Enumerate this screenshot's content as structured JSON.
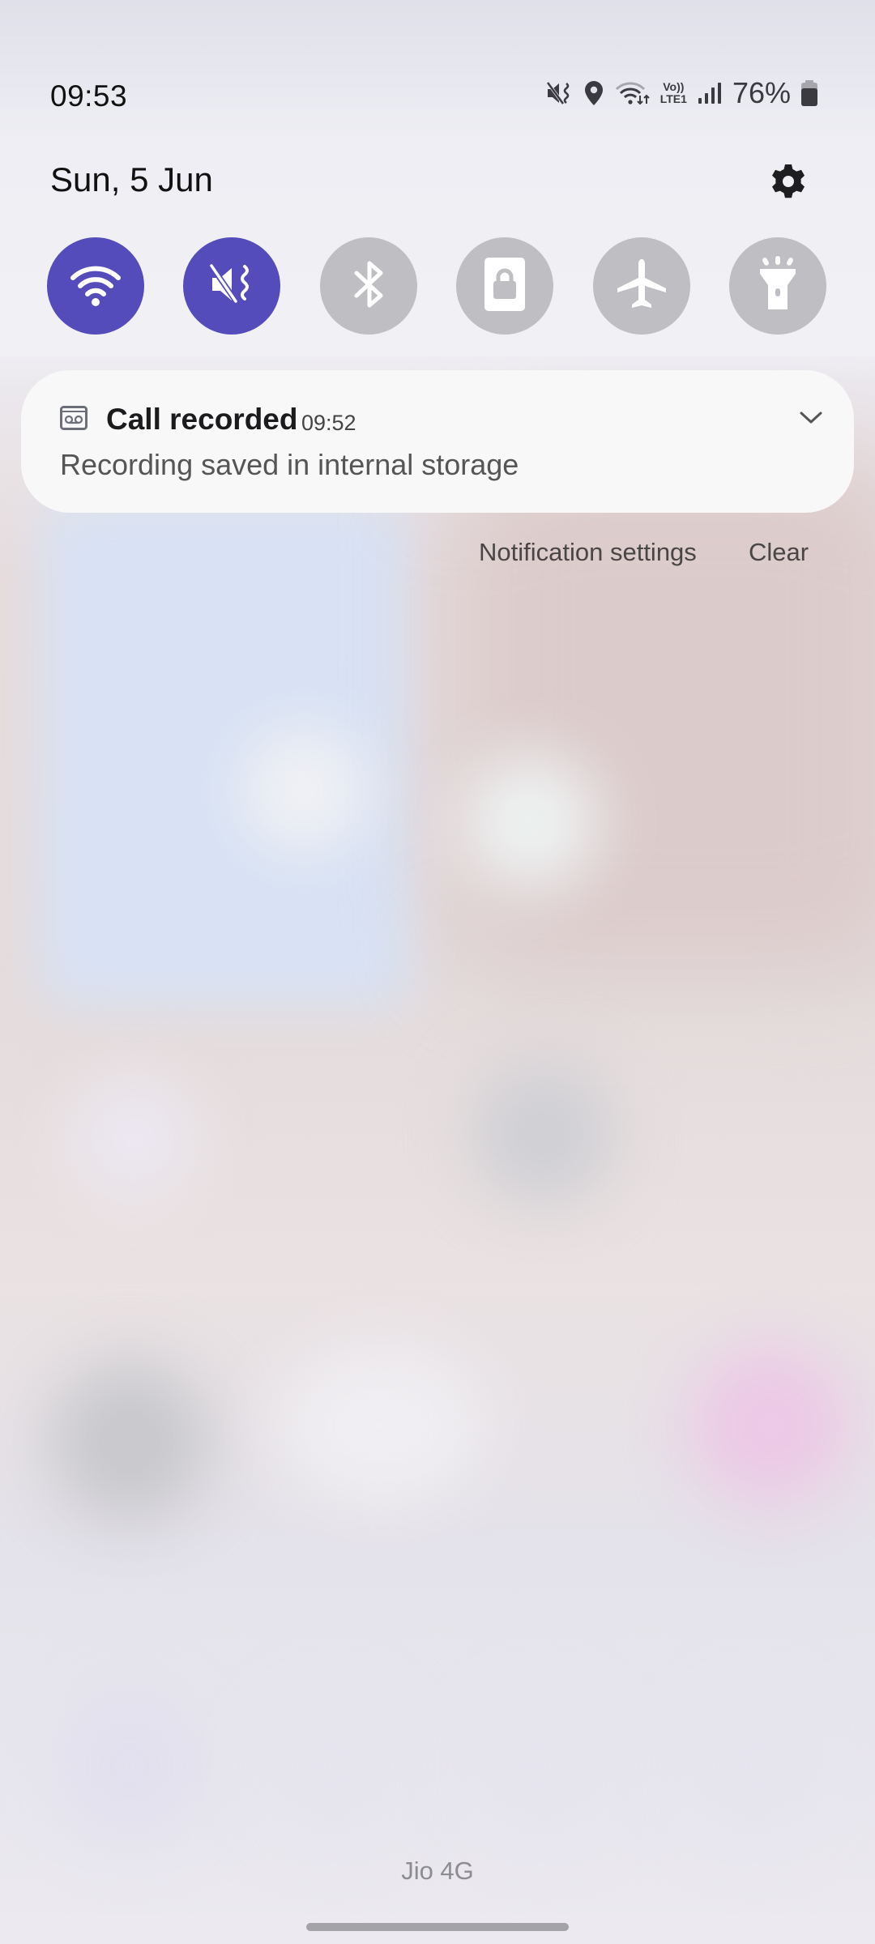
{
  "status_bar": {
    "time": "09:53",
    "icons": [
      "mute-vibrate-icon",
      "location-icon",
      "wifi-data-icon",
      "volte-lte-icon",
      "signal-icon"
    ],
    "volte_label_top": "Vo))",
    "volte_label_bottom": "LTE1",
    "battery_percent": "76%"
  },
  "header": {
    "date": "Sun, 5 Jun",
    "settings_icon": "gear-icon"
  },
  "quick_settings": [
    {
      "name": "wifi",
      "icon": "wifi-icon",
      "state": "on"
    },
    {
      "name": "sound-mute-vibrate",
      "icon": "mute-vibrate-icon",
      "state": "on"
    },
    {
      "name": "bluetooth",
      "icon": "bluetooth-icon",
      "state": "off"
    },
    {
      "name": "secure-folder",
      "icon": "lock-icon",
      "state": "off"
    },
    {
      "name": "airplane-mode",
      "icon": "airplane-icon",
      "state": "off"
    },
    {
      "name": "flashlight",
      "icon": "flashlight-icon",
      "state": "off"
    }
  ],
  "colors": {
    "tile_on": "#544cba",
    "tile_off": "#bfbfc3",
    "panel_bg": "#f1f1f5"
  },
  "notification": {
    "app_icon": "voicemail-tape-icon",
    "title": "Call recorded",
    "time": "09:52",
    "body": "Recording saved in internal storage"
  },
  "notification_actions": {
    "settings_label": "Notification settings",
    "clear_label": "Clear"
  },
  "footer": {
    "carrier": "Jio 4G"
  }
}
